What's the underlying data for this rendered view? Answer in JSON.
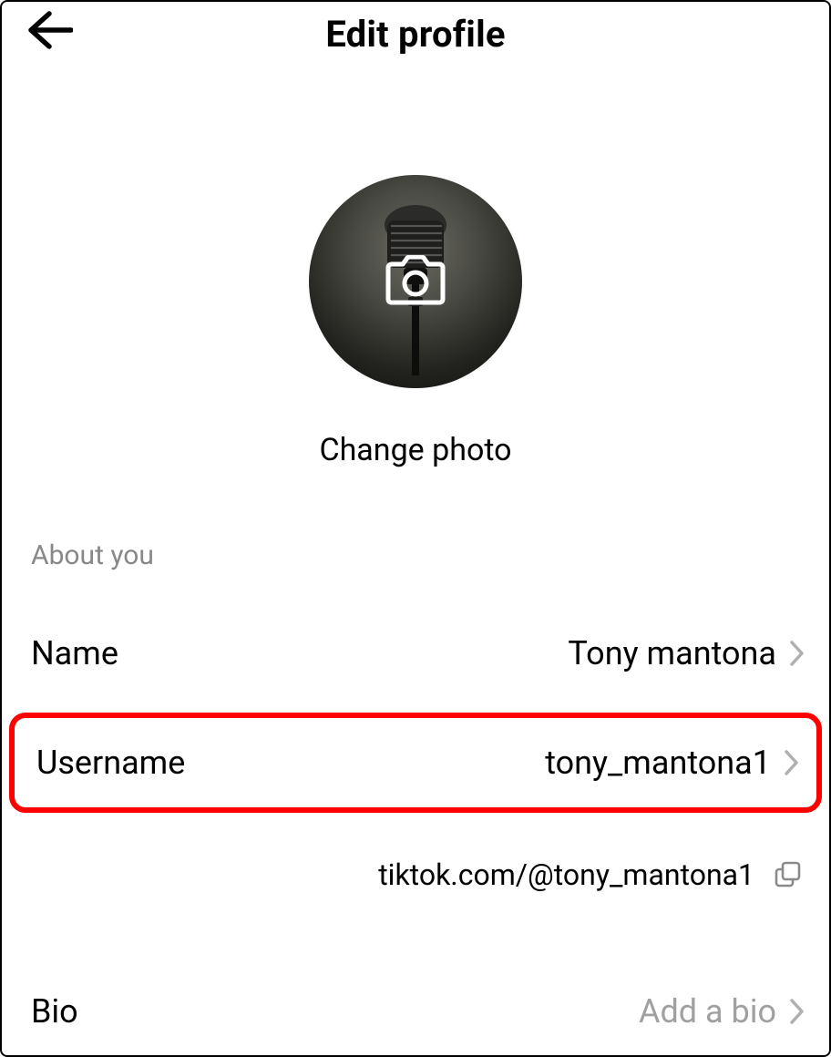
{
  "header": {
    "title": "Edit profile"
  },
  "avatar": {
    "change_label": "Change photo"
  },
  "section": {
    "about_label": "About you"
  },
  "rows": {
    "name": {
      "label": "Name",
      "value": "Tony mantona"
    },
    "username": {
      "label": "Username",
      "value": "tony_mantona1"
    },
    "bio": {
      "label": "Bio",
      "placeholder": "Add a bio"
    }
  },
  "profile_url": "tiktok.com/@tony_mantona1"
}
